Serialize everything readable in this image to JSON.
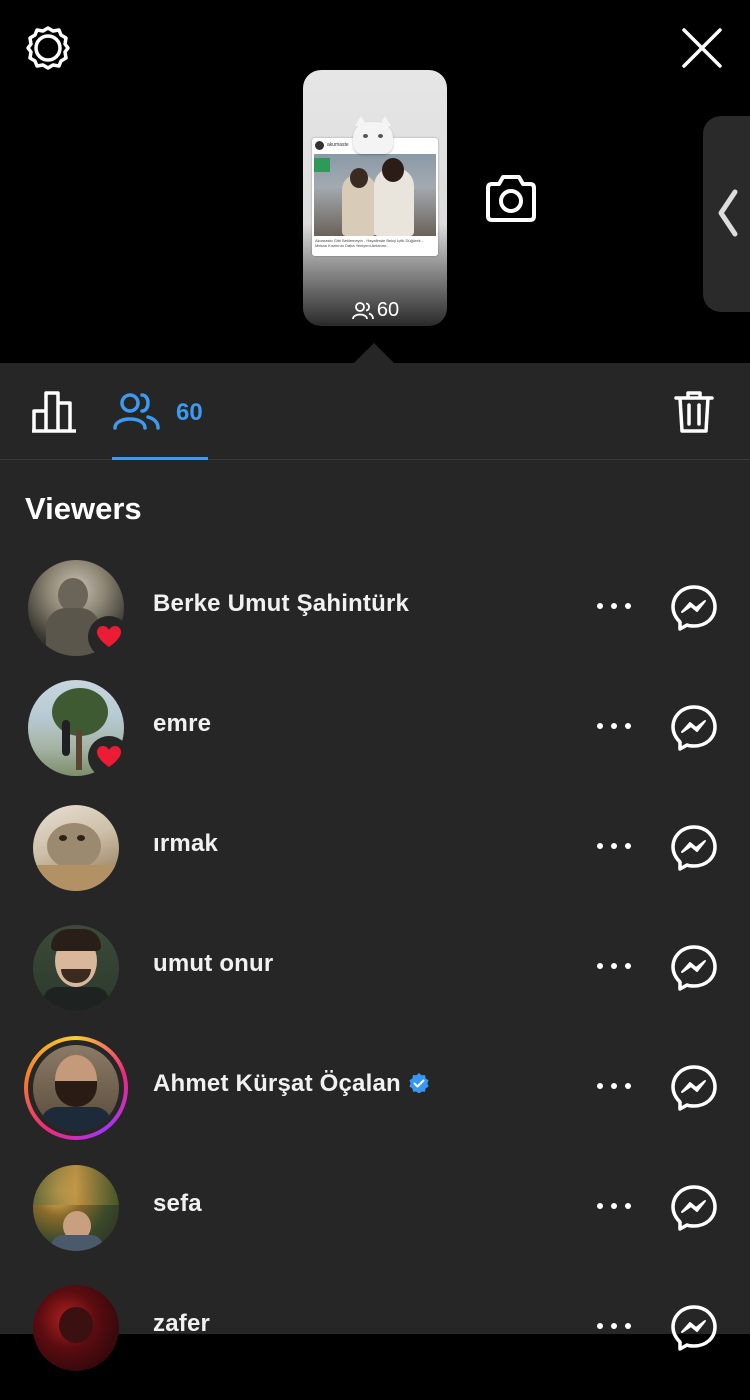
{
  "story": {
    "viewer_count": "60",
    "card_username": "akumaste",
    "card_caption": "Akumasto Gibi Beklemeyin - Hayalimde Bekçi İçtik Düğürek - Mekan Kısmının Daha Yeniyeni Anlatımı..."
  },
  "tabs": {
    "viewers_count": "60"
  },
  "section_title": "Viewers",
  "viewers": [
    {
      "name": "Berke Umut Şahintürk",
      "liked": true,
      "verified": false,
      "ring": false
    },
    {
      "name": "emre",
      "liked": true,
      "verified": false,
      "ring": false
    },
    {
      "name": "ırmak",
      "liked": false,
      "verified": false,
      "ring": false
    },
    {
      "name": "umut onur",
      "liked": false,
      "verified": false,
      "ring": false
    },
    {
      "name": "Ahmet Kürşat Öçalan",
      "liked": false,
      "verified": true,
      "ring": true
    },
    {
      "name": "sefa",
      "liked": false,
      "verified": false,
      "ring": false
    },
    {
      "name": "zafer",
      "liked": false,
      "verified": false,
      "ring": false
    }
  ],
  "colors": {
    "accent": "#3c9af0",
    "panel_bg": "#262626",
    "like": "#ed1c35",
    "verified": "#3897f0"
  },
  "icons": [
    "settings-icon",
    "close-icon",
    "camera-icon",
    "chevron-left-icon",
    "insights-icon",
    "people-icon",
    "trash-icon",
    "heart-icon",
    "verified-icon",
    "more-icon",
    "messenger-icon"
  ]
}
